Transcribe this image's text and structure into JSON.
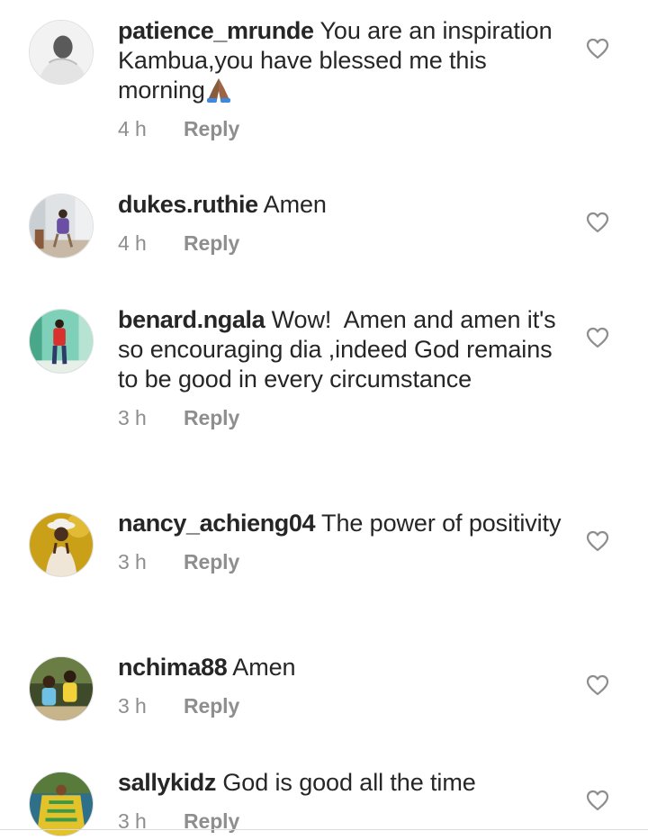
{
  "comments": [
    {
      "username": "patience_mrunde",
      "text": "You are an inspiration Kambua,you have blessed me this morning",
      "emoji": "folded-hands-emoji",
      "time": "4 h",
      "reply_label": "Reply"
    },
    {
      "username": "dukes.ruthie",
      "text": "Amen",
      "time": "4 h",
      "reply_label": "Reply"
    },
    {
      "username": "benard.ngala",
      "text": "Wow!  Amen and amen it's so encouraging dia ,indeed God remains to be good in every circumstance",
      "time": "3 h",
      "reply_label": "Reply"
    },
    {
      "username": "nancy_achieng04",
      "text": "The power of positivity",
      "time": "3 h",
      "reply_label": "Reply"
    },
    {
      "username": "nchima88",
      "text": "Amen",
      "time": "3 h",
      "reply_label": "Reply"
    },
    {
      "username": "sallykidz",
      "text": "God is good all the time",
      "time": "3 h",
      "reply_label": "Reply"
    }
  ],
  "icons": {
    "like": "heart-outline-icon"
  },
  "colors": {
    "text": "#262626",
    "meta": "#8e8e8e",
    "icon": "#8e8e8e"
  }
}
